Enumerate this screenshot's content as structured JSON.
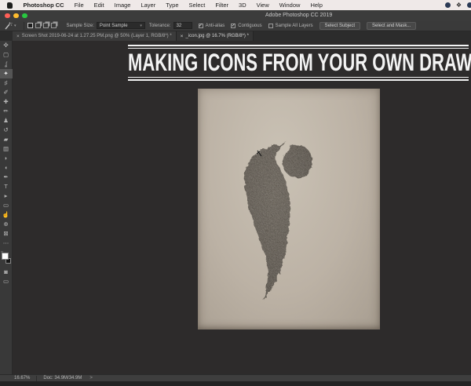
{
  "menubar": {
    "items": [
      "Photoshop CC",
      "File",
      "Edit",
      "Image",
      "Layer",
      "Type",
      "Select",
      "Filter",
      "3D",
      "View",
      "Window",
      "Help"
    ],
    "status_glyph": "❖"
  },
  "titlebar": {
    "title": "Adobe Photoshop CC 2019"
  },
  "options": {
    "wand_caret": "▾",
    "sample_size_label": "Sample Size:",
    "sample_size_value": "Point Sample",
    "field_caret": "▾",
    "tolerance_label": "Tolerance:",
    "tolerance_value": "32",
    "check_glyph": "✓",
    "anti_alias_label": "Anti-alias",
    "contiguous_label": "Contiguous",
    "sample_all_layers_label": "Sample All Layers",
    "select_subject_label": "Select Subject",
    "select_and_mask_label": "Select and Mask..."
  },
  "tabs": [
    {
      "close": "×",
      "title": "Screen Shot 2019-06-24 at 1.27.25 PM.png @ 50% (Layer 1, RGB/8*) *"
    },
    {
      "close": "×",
      "title": "_icon.jpg @ 16.7% (RGB/8*) *"
    }
  ],
  "toolbar": {
    "tools": [
      {
        "name": "move-tool",
        "glyph": "✜"
      },
      {
        "name": "rectangular-marquee-tool",
        "glyph": "▢"
      },
      {
        "name": "lasso-tool",
        "glyph": "ʆ"
      },
      {
        "name": "magic-wand-tool",
        "glyph": "✦"
      },
      {
        "name": "crop-tool",
        "glyph": "♯"
      },
      {
        "name": "eyedropper-tool",
        "glyph": "✐"
      },
      {
        "name": "healing-brush-tool",
        "glyph": "✚"
      },
      {
        "name": "brush-tool",
        "glyph": "✏"
      },
      {
        "name": "clone-stamp-tool",
        "glyph": "♟"
      },
      {
        "name": "history-brush-tool",
        "glyph": "↺"
      },
      {
        "name": "eraser-tool",
        "glyph": "▰"
      },
      {
        "name": "gradient-tool",
        "glyph": "▥"
      },
      {
        "name": "blur-tool",
        "glyph": "◗"
      },
      {
        "name": "dodge-tool",
        "glyph": "◖"
      },
      {
        "name": "pen-tool",
        "glyph": "✒"
      },
      {
        "name": "type-tool",
        "glyph": "T"
      },
      {
        "name": "path-selection-tool",
        "glyph": "▸"
      },
      {
        "name": "rectangle-tool",
        "glyph": "▭"
      },
      {
        "name": "hand-tool",
        "glyph": "☝"
      },
      {
        "name": "zoom-tool",
        "glyph": "⊕"
      },
      {
        "name": "frame-tool",
        "glyph": "⊠"
      },
      {
        "name": "edit-toolbar",
        "glyph": "⋯"
      }
    ],
    "quick_mask_glyph": "◙",
    "screen_mode_glyph": "▭"
  },
  "canvas": {
    "headline": "MAKING ICONS FROM YOUR OWN DRAWINGS"
  },
  "statusbar": {
    "zoom_value": "16.67%",
    "doc_label": "Doc: 34.9M/34.9M",
    "chevron": ">"
  },
  "colors": {
    "menubar_bg": "#efe9e8",
    "chrome_bg": "#3a3a3a",
    "canvas_bg": "#2d2b2b",
    "paper": "#bcb2a5",
    "headline_text": "#f3f3f3",
    "traffic_red": "#ff5f57",
    "traffic_yellow": "#febc2e",
    "traffic_green": "#28c840"
  }
}
